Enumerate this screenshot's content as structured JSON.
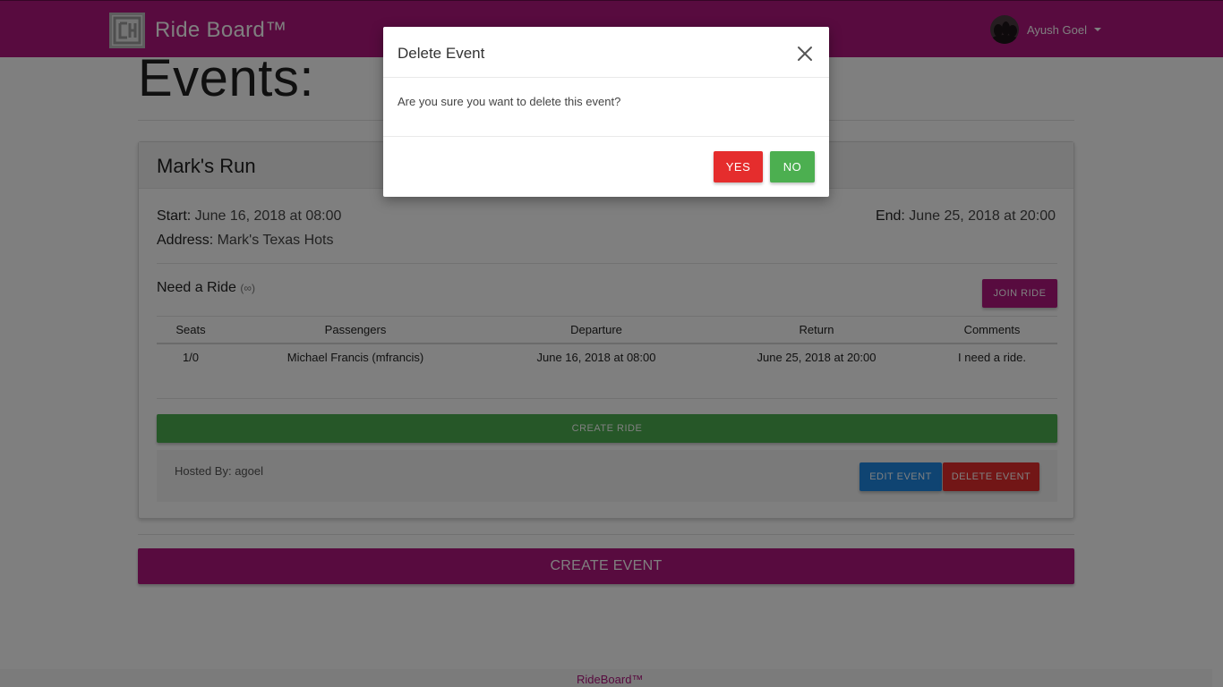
{
  "navbar": {
    "brand_name": "Ride Board™",
    "user_name": "Ayush Goel"
  },
  "page": {
    "title": "Events:"
  },
  "event": {
    "name": "Mark's Run",
    "start_label": "Start:",
    "start_value": " June 16, 2018 at 08:00",
    "end_label": "End:",
    "end_value": " June 25, 2018 at 20:00",
    "address_label": "Address:",
    "address_value": " Mark's Texas Hots",
    "need_ride_label": "Need a Ride",
    "need_ride_count": "(∞)",
    "join_ride_label": "JOIN RIDE",
    "table": {
      "headers": [
        "Seats",
        "Passengers",
        "Departure",
        "Return",
        "Comments"
      ],
      "rows": [
        [
          "1/0",
          "Michael Francis (mfrancis)",
          "June 16, 2018 at 08:00",
          "June 25, 2018 at 20:00",
          "I need a ride."
        ]
      ]
    },
    "create_ride_label": "CREATE RIDE",
    "hosted_by": "Hosted By: agoel",
    "edit_event_label": "EDIT EVENT",
    "delete_event_label": "DELETE EVENT"
  },
  "create_event_label": "CREATE EVENT",
  "footer": {
    "text": "RideBoard™"
  },
  "modal": {
    "title": "Delete Event",
    "body": "Are you sure you want to delete this event?",
    "yes_label": "YES",
    "no_label": "NO"
  },
  "colors": {
    "brand": "#b0177f",
    "success": "#4caf50",
    "danger": "#e52d2d",
    "primary": "#1e88e5"
  },
  "icons": {
    "logo": "csh-logo-icon",
    "close": "close-icon",
    "caret": "chevron-down-icon"
  }
}
